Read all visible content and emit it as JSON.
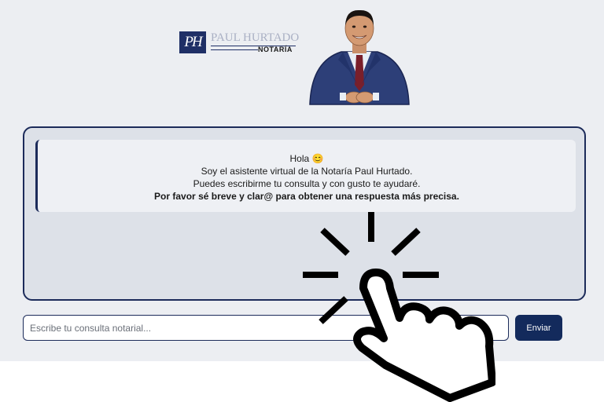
{
  "header": {
    "logo": {
      "monogram": "PH",
      "name": "PAUL HURTADO",
      "subtitle": "NOTARÍA"
    },
    "avatar_icon": "notary-avatar-illustration"
  },
  "chat": {
    "messages": [
      {
        "sender": "bot",
        "lines": [
          "Hola 😊",
          "Soy el asistente virtual de la Notaría Paul Hurtado.",
          "Puedes escribirme tu consulta y con gusto te ayudaré."
        ],
        "emphasis": "Por favor sé breve y clar@ para obtener una respuesta más precisa."
      }
    ]
  },
  "input": {
    "placeholder": "Escribe tu consulta notarial...",
    "value": "",
    "send_label": "Enviar"
  },
  "overlay": {
    "icon": "click-hand-icon"
  },
  "colors": {
    "primary": "#1c2b5a",
    "button": "#132a5c",
    "page_bg": "#eceef2",
    "chat_bg": "#dde1e8",
    "bubble_bg": "#eef0f4"
  }
}
